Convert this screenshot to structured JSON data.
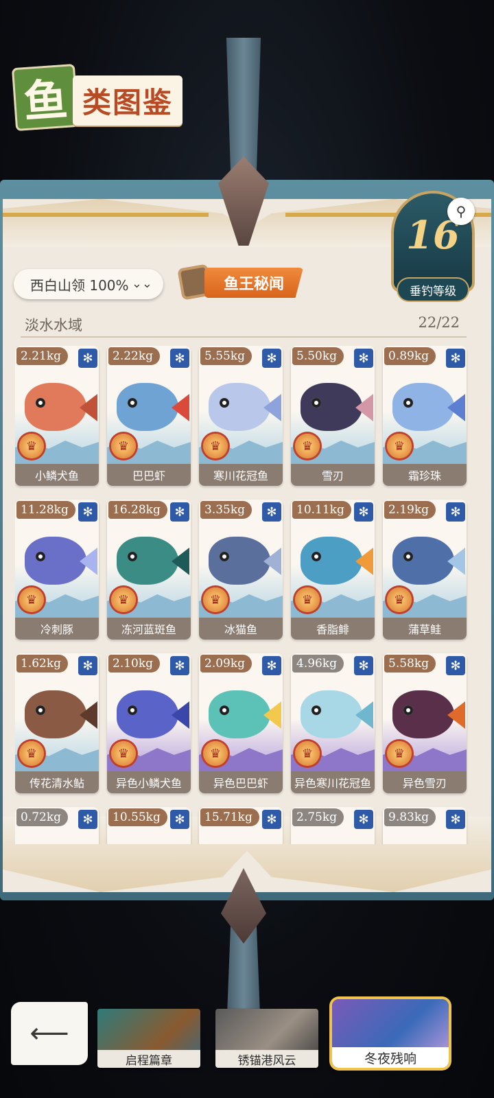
{
  "logo": {
    "char": "鱼",
    "title": "类图鉴"
  },
  "region": {
    "label": "西白山领 100%",
    "chevron": "⌄⌄"
  },
  "secret": {
    "label": "鱼王秘闻"
  },
  "level": {
    "number": "16",
    "label": "垂钓等级"
  },
  "waters": {
    "label": "淡水水域",
    "count": "22/22"
  },
  "colors": {
    "accent": "#d8641c",
    "level_bg": "#173a45",
    "card_name_bg": "#8b7c72"
  },
  "fish": [
    {
      "weight": "2.21kg",
      "name": "小鳞犬鱼",
      "color": "#e07a5a",
      "tail": "#c0523a",
      "variant": "blue",
      "tag": "brown"
    },
    {
      "weight": "2.22kg",
      "name": "巴巴虾",
      "color": "#6ea3d4",
      "tail": "#d94a3a",
      "variant": "blue",
      "tag": "brown"
    },
    {
      "weight": "5.55kg",
      "name": "寒川花冠鱼",
      "color": "#b9c8ea",
      "tail": "#8ea2dc",
      "variant": "blue",
      "tag": "brown"
    },
    {
      "weight": "5.50kg",
      "name": "雪刃",
      "color": "#3f3a5a",
      "tail": "#d497a8",
      "variant": "blue",
      "tag": "brown"
    },
    {
      "weight": "0.89kg",
      "name": "霜珍珠",
      "color": "#8fb3e4",
      "tail": "#5d7fd1",
      "variant": "blue",
      "tag": "brown"
    },
    {
      "weight": "11.28kg",
      "name": "冷刺豚",
      "color": "#6a6fc8",
      "tail": "#a7b4ef",
      "variant": "blue",
      "tag": "brown"
    },
    {
      "weight": "16.28kg",
      "name": "冻河蓝斑鱼",
      "color": "#3c8c86",
      "tail": "#1f5a58",
      "variant": "blue",
      "tag": "brown"
    },
    {
      "weight": "3.35kg",
      "name": "冰猫鱼",
      "color": "#5a6f9c",
      "tail": "#9fb1d4",
      "variant": "blue",
      "tag": "brown"
    },
    {
      "weight": "10.11kg",
      "name": "香脂鲱",
      "color": "#4c9ec4",
      "tail": "#f09a3a",
      "variant": "blue",
      "tag": "brown"
    },
    {
      "weight": "2.19kg",
      "name": "蒲草鲑",
      "color": "#4e6fa8",
      "tail": "#a4c6e6",
      "variant": "blue",
      "tag": "brown"
    },
    {
      "weight": "1.62kg",
      "name": "传花清水鲇",
      "color": "#8a5a44",
      "tail": "#5e3a2c",
      "variant": "blue",
      "tag": "brown"
    },
    {
      "weight": "2.10kg",
      "name": "异色小鳞犬鱼",
      "color": "#5a63c8",
      "tail": "#3b47a8",
      "variant": "purple",
      "tag": "brown"
    },
    {
      "weight": "2.09kg",
      "name": "异色巴巴虾",
      "color": "#5cc2b8",
      "tail": "#f2c94c",
      "variant": "purple",
      "tag": "brown"
    },
    {
      "weight": "4.96kg",
      "name": "异色寒川花冠鱼",
      "color": "#a8d8e6",
      "tail": "#6fb6cf",
      "variant": "purple",
      "tag": "grey"
    },
    {
      "weight": "5.58kg",
      "name": "异色雪刃",
      "color": "#5a2f4a",
      "tail": "#e06a2a",
      "variant": "purple",
      "tag": "brown"
    },
    {
      "weight": "0.72kg",
      "name": "",
      "color": "#7a6a5a",
      "tail": "#4a3a2a",
      "variant": "blue",
      "tag": "grey"
    },
    {
      "weight": "10.55kg",
      "name": "",
      "color": "#8a7a6a",
      "tail": "#4a3a2a",
      "variant": "blue",
      "tag": "brown"
    },
    {
      "weight": "15.71kg",
      "name": "",
      "color": "#3a4a7a",
      "tail": "#2a3a6a",
      "variant": "blue",
      "tag": "brown"
    },
    {
      "weight": "2.75kg",
      "name": "",
      "color": "#c8d0e0",
      "tail": "#a0a8c0",
      "variant": "blue",
      "tag": "grey"
    },
    {
      "weight": "9.83kg",
      "name": "",
      "color": "#e0a050",
      "tail": "#c06030",
      "variant": "blue",
      "tag": "grey"
    }
  ],
  "chapters": [
    {
      "label": "启程篇章",
      "art": "linear-gradient(135deg,#2f7a7a,#8a5a30 60%,#3a6a80)",
      "active": false
    },
    {
      "label": "锈锚港风云",
      "art": "linear-gradient(135deg,#5a5a5a,#9a8f84 55%,#3a3a3a)",
      "active": false
    },
    {
      "label": "冬夜残响",
      "art": "linear-gradient(135deg,#7a5ab8,#3a6ab8 55%,#c8a0e0)",
      "active": true
    }
  ]
}
